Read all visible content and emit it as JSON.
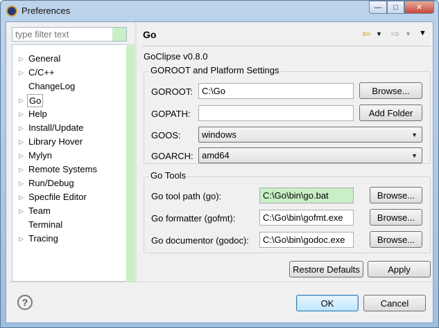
{
  "window": {
    "title": "Preferences"
  },
  "filter": {
    "placeholder": "type filter text"
  },
  "tree": [
    {
      "label": "General",
      "expandable": true
    },
    {
      "label": "C/C++",
      "expandable": true
    },
    {
      "label": "ChangeLog",
      "expandable": false
    },
    {
      "label": "Go",
      "expandable": true,
      "selected": true
    },
    {
      "label": "Help",
      "expandable": true
    },
    {
      "label": "Install/Update",
      "expandable": true
    },
    {
      "label": "Library Hover",
      "expandable": true
    },
    {
      "label": "Mylyn",
      "expandable": true
    },
    {
      "label": "Remote Systems",
      "expandable": true
    },
    {
      "label": "Run/Debug",
      "expandable": true
    },
    {
      "label": "Specfile Editor",
      "expandable": true
    },
    {
      "label": "Team",
      "expandable": true
    },
    {
      "label": "Terminal",
      "expandable": false
    },
    {
      "label": "Tracing",
      "expandable": true
    }
  ],
  "page": {
    "title": "Go",
    "version": "GoClipse v0.8.0"
  },
  "goroot_group": {
    "title": "GOROOT and Platform Settings",
    "goroot_label": "GOROOT:",
    "goroot_value": "C:\\Go",
    "goroot_browse": "Browse...",
    "gopath_label": "GOPATH:",
    "gopath_value": "",
    "add_folder": "Add Folder",
    "goos_label": "GOOS:",
    "goos_value": "windows",
    "goarch_label": "GOARCH:",
    "goarch_value": "amd64"
  },
  "tools_group": {
    "title": "Go Tools",
    "tool_label": "Go tool path (go):",
    "tool_value": "C:\\Go\\bin\\go.bat",
    "fmt_label": "Go formatter (gofmt):",
    "fmt_value": "C:\\Go\\bin\\gofmt.exe",
    "doc_label": "Go documentor (godoc):",
    "doc_value": "C:\\Go\\bin\\godoc.exe",
    "browse": "Browse..."
  },
  "buttons": {
    "restore_defaults": "Restore Defaults",
    "apply": "Apply",
    "ok": "OK",
    "cancel": "Cancel"
  },
  "colors": {
    "field_highlight": "#c9efc6",
    "default_button": "#bee6fd"
  }
}
